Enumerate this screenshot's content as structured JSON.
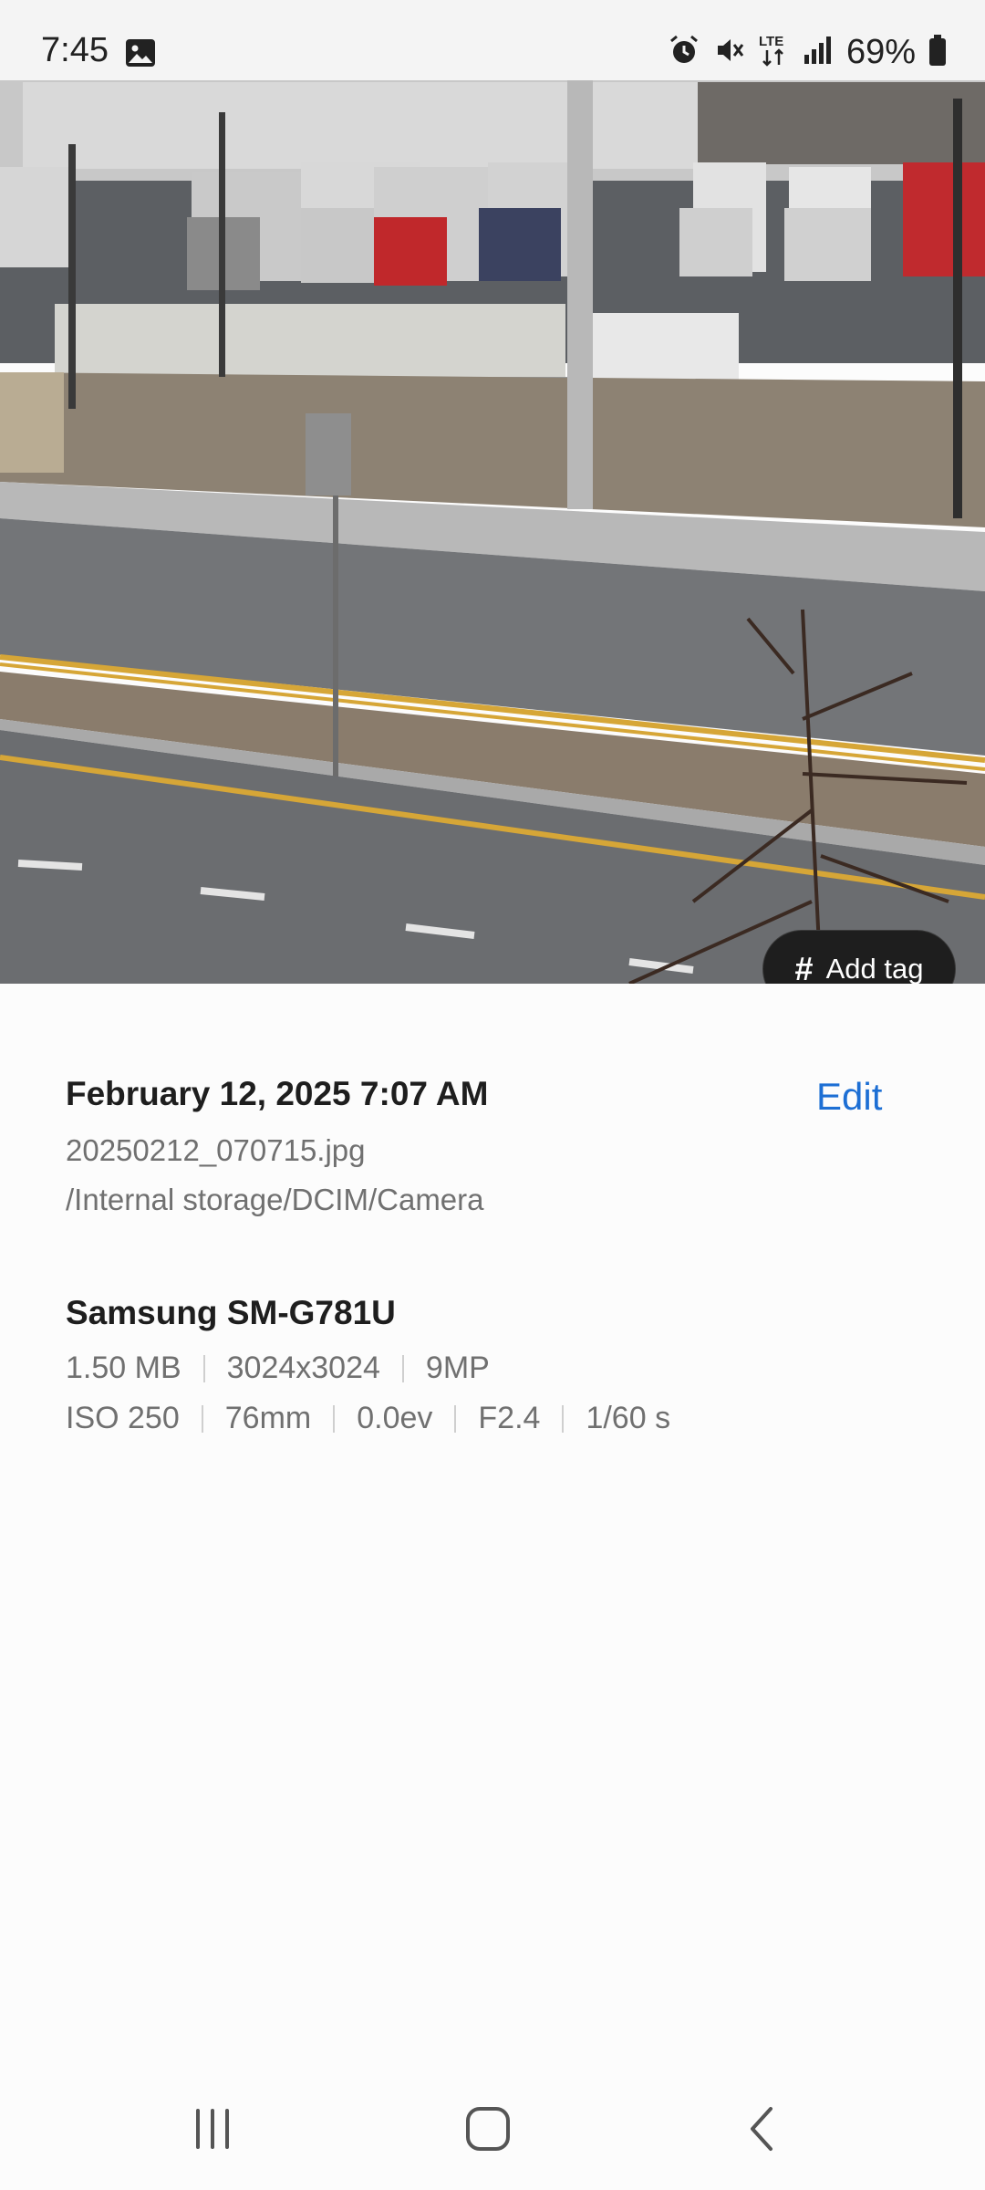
{
  "status_bar": {
    "time": "7:45",
    "battery_percent": "69%",
    "icons": [
      "gallery-notification-icon",
      "alarm-icon",
      "mute-icon",
      "lte-icon",
      "signal-icon",
      "battery-icon"
    ]
  },
  "photo": {
    "add_tag_label": "Add tag",
    "add_tag_icon": "hash-icon"
  },
  "details": {
    "datetime": "February 12, 2025 7:07 AM",
    "edit_label": "Edit",
    "filename": "20250212_070715.jpg",
    "path": "/Internal storage/DCIM/Camera",
    "device": "Samsung SM-G781U",
    "file_specs": [
      "1.50 MB",
      "3024x3024",
      "9MP"
    ],
    "camera_specs": [
      "ISO 250",
      "76mm",
      "0.0ev",
      "F2.4",
      "1/60 s"
    ]
  },
  "nav_bar": {
    "buttons": [
      "recent-apps-icon",
      "home-icon",
      "back-icon"
    ]
  },
  "colors": {
    "accent": "#1d6fd4",
    "background": "#fcfcfc",
    "tag_pill": "#1e1e1e"
  }
}
